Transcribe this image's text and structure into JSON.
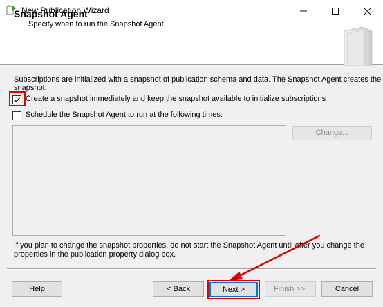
{
  "window": {
    "title": "New Publication Wizard",
    "controls": {
      "minimize": "minimize-icon",
      "maximize": "maximize-icon",
      "close": "close-icon"
    }
  },
  "header": {
    "title": "Snapshot Agent",
    "subtitle": "Specify when to run the Snapshot Agent."
  },
  "intro": {
    "line1": "Subscriptions are initialized with a snapshot of publication schema and data. The Snapshot Agent creates the",
    "line2": "snapshot."
  },
  "options": [
    {
      "label": "Create a snapshot immediately and keep the snapshot available to initialize subscriptions",
      "checked": true
    },
    {
      "label": "Schedule the Snapshot Agent to run at the following times:",
      "checked": false
    }
  ],
  "change_button": "Change...",
  "note": {
    "line1": "If you plan to change the snapshot properties, do not start the Snapshot Agent until after you change the",
    "line2": "properties in the publication property dialog box."
  },
  "buttons": {
    "help": "Help",
    "back": "< Back",
    "next": "Next >",
    "finish": "Finish >>|",
    "cancel": "Cancel"
  },
  "colors": {
    "highlight": "#e00000",
    "accent": "#0078d7"
  }
}
